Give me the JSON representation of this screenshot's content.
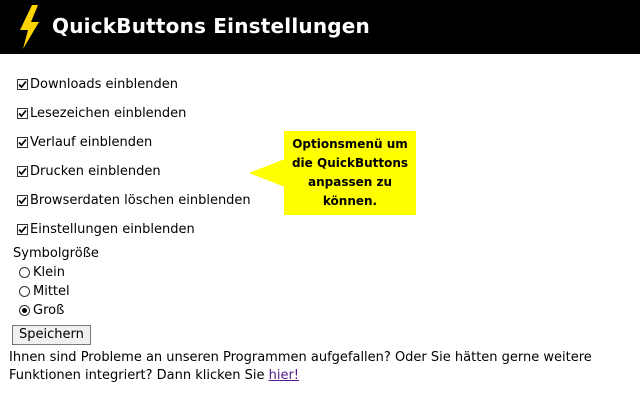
{
  "header": {
    "title": "QuickButtons Einstellungen",
    "logo_icon": "lightning-bolt-icon",
    "background": "#000000",
    "accent": "#ffd400"
  },
  "options": [
    {
      "label": "Downloads einblenden",
      "checked": true
    },
    {
      "label": "Lesezeichen einblenden",
      "checked": true
    },
    {
      "label": "Verlauf einblenden",
      "checked": true
    },
    {
      "label": "Drucken einblenden",
      "checked": true
    },
    {
      "label": "Browserdaten löschen einblenden",
      "checked": true
    },
    {
      "label": "Einstellungen einblenden",
      "checked": true
    }
  ],
  "symbol_size": {
    "label": "Symbolgröße",
    "choices": [
      {
        "label": "Klein",
        "selected": false
      },
      {
        "label": "Mittel",
        "selected": false
      },
      {
        "label": "Groß",
        "selected": true
      }
    ]
  },
  "save_label": "Speichern",
  "footer": {
    "text": "Ihnen sind Probleme an unseren Programmen aufgefallen? Oder Sie hätten gerne weitere Funktionen integriert?  Dann klicken Sie ",
    "link": "hier!"
  },
  "tooltip": {
    "text": "Optionsmenü um die QuickButtons anpassen zu können.",
    "color": "#ffff00"
  }
}
